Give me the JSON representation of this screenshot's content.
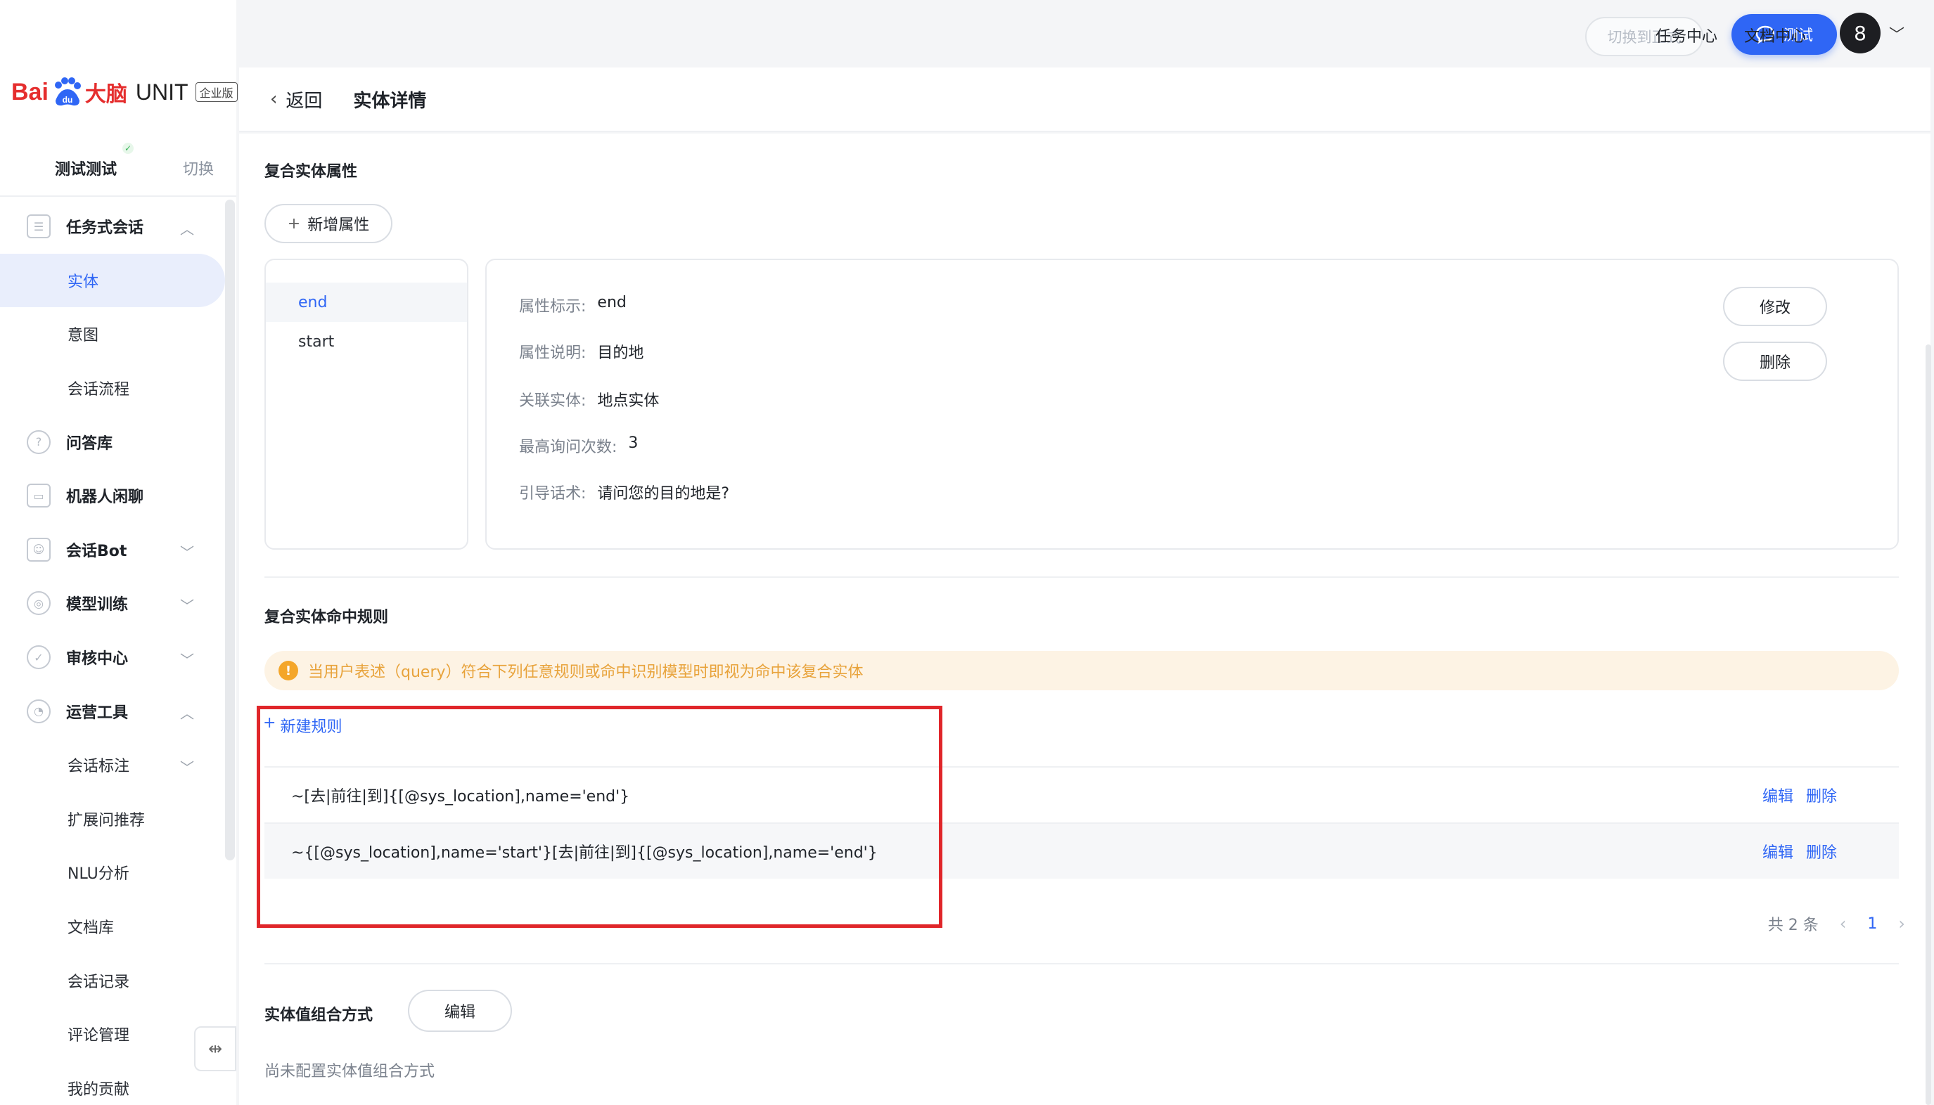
{
  "brand": {
    "bai": "Bai",
    "paw_alt": "du",
    "dn": "大脑",
    "unit": "UNIT",
    "edition_tag": "企业版"
  },
  "workspace": {
    "name": "测试测试",
    "switch_label": "切换"
  },
  "sidebar": {
    "items": [
      {
        "label": "任务式会话",
        "icon": "task-session-icon",
        "chevron": "up"
      },
      {
        "label": "实体",
        "sub": true,
        "active": true
      },
      {
        "label": "意图",
        "sub": true
      },
      {
        "label": "会话流程",
        "sub": true
      },
      {
        "label": "问答库",
        "icon": "qa-icon"
      },
      {
        "label": "机器人闲聊",
        "icon": "chat-icon"
      },
      {
        "label": "会话Bot",
        "icon": "bot-icon",
        "chevron": "down"
      },
      {
        "label": "模型训练",
        "icon": "model-icon",
        "chevron": "down"
      },
      {
        "label": "审核中心",
        "icon": "shield-icon",
        "chevron": "down"
      },
      {
        "label": "运营工具",
        "icon": "tools-icon",
        "chevron": "up"
      },
      {
        "label": "会话标注",
        "sub": true,
        "chevron": "down"
      },
      {
        "label": "扩展问推荐",
        "sub": true
      },
      {
        "label": "NLU分析",
        "sub": true
      },
      {
        "label": "文档库",
        "sub": true
      },
      {
        "label": "会话记录",
        "sub": true
      },
      {
        "label": "评论管理",
        "sub": true
      },
      {
        "label": "我的贡献",
        "sub": true
      }
    ]
  },
  "topbar": {
    "switch_formal": "切换到正式",
    "test": "测试",
    "task_center": "任务中心",
    "doc_center": "文档中心",
    "avatar": "8"
  },
  "header": {
    "back": "返回",
    "title": "实体详情"
  },
  "attributes": {
    "section_title": "复合实体属性",
    "add_button": "新增属性",
    "list": [
      "end",
      "start"
    ],
    "selected": {
      "id_label": "属性标示:",
      "id_value": "end",
      "desc_label": "属性说明:",
      "desc_value": "目的地",
      "entity_label": "关联实体:",
      "entity_value": "地点实体",
      "max_label": "最高询问次数:",
      "max_value": "3",
      "guide_label": "引导话术:",
      "guide_value": "请问您的目的地是?"
    },
    "edit_button": "修改",
    "delete_button": "删除"
  },
  "rules": {
    "section_title": "复合实体命中规则",
    "notice": "当用户表述（query）符合下列任意规则或命中识别模型时即视为命中该复合实体",
    "new_rule": "新建规则",
    "rows": [
      {
        "text": "~[去|前往|到]{[@sys_location],name='end'}",
        "edit": "编辑",
        "delete": "删除"
      },
      {
        "text": "~{[@sys_location],name='start'}[去|前往|到]{[@sys_location],name='end'}",
        "edit": "编辑",
        "delete": "删除"
      }
    ],
    "total": "共 2 条",
    "page": "1"
  },
  "combination": {
    "section_title": "实体值组合方式",
    "edit_button": "编辑",
    "empty_text": "尚未配置实体值组合方式"
  },
  "colors": {
    "accent": "#2f66f5",
    "highlight": "#e0262a",
    "notice_bg": "#fdf3e4",
    "notice_text": "#e8a33b",
    "brand_red": "#e52e2e"
  }
}
